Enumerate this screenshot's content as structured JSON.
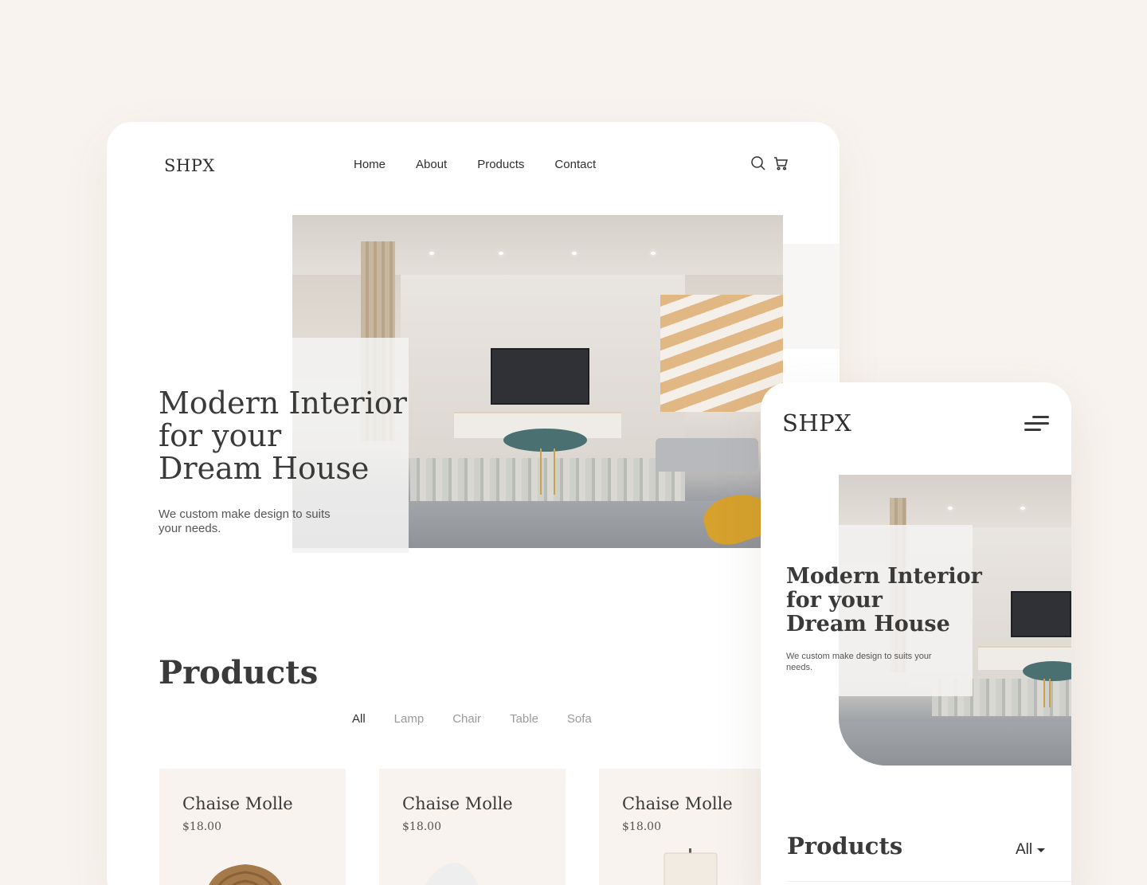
{
  "brand": {
    "logo": "SHPX"
  },
  "desktop": {
    "nav": [
      "Home",
      "About",
      "Products",
      "Contact"
    ],
    "icons": {
      "search": "search-icon",
      "cart": "cart-icon"
    },
    "hero": {
      "title": "Modern Interior\nfor your\nDream House",
      "subtitle": "We custom make design to suits your needs."
    },
    "products": {
      "title": "Products",
      "filters": [
        "All",
        "Lamp",
        "Chair",
        "Table",
        "Sofa"
      ],
      "active_filter": "All",
      "cards": [
        {
          "name": "Chaise Molle",
          "price": "$18.00",
          "visual": "wicker-chair"
        },
        {
          "name": "Chaise Molle",
          "price": "$18.00",
          "visual": "white-chair"
        },
        {
          "name": "Chaise Molle",
          "price": "$18.00",
          "visual": "table-lamp"
        }
      ]
    }
  },
  "mobile": {
    "menu_icon": "hamburger-icon",
    "hero": {
      "title": "Modern Interior\nfor your\nDream House",
      "subtitle": "We custom make design to suits your needs."
    },
    "products": {
      "title": "Products",
      "filter_value": "All"
    }
  },
  "colors": {
    "page_bg": "#f8f3ee",
    "card_bg": "#f8f3ee",
    "text_dark": "#3a3a3a",
    "text_muted": "#9a9a9a",
    "accent_gold": "#d6a12c"
  }
}
